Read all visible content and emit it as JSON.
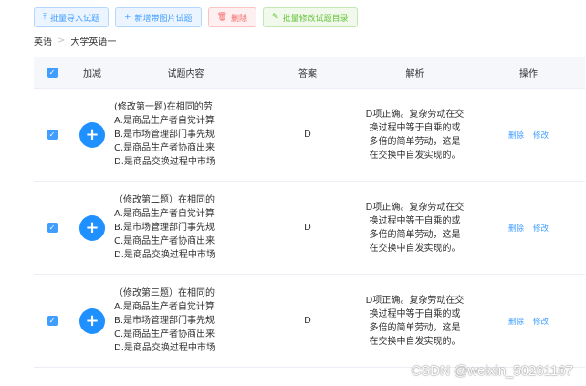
{
  "toolbar": {
    "import_label": "批量导入试题",
    "add_image_label": "新增带图片试题",
    "delete_label": "删除",
    "batch_edit_label": "批量修改试题目录"
  },
  "breadcrumb": [
    "英语",
    "大学英语一"
  ],
  "table": {
    "headers": {
      "add": "加减",
      "content": "试题内容",
      "answer": "答案",
      "analysis": "解析",
      "ops": "操作"
    },
    "rows": [
      {
        "content": [
          "(修改第一题)在相同的劳",
          "A.是商品生产者自觉计算",
          "B.是市场管理部门事先规",
          "C.是商品生产者协商出来",
          "D.是商品交换过程中市场"
        ],
        "answer": "D",
        "analysis": "D项正确。复杂劳动在交换过程中等于自乘的或多倍的简单劳动，这是在交换中自发实现的。",
        "delete": "删除",
        "edit": "修改"
      },
      {
        "content": [
          "（修改第二题）在相同的",
          "A.是商品生产者自觉计算",
          "B.是市场管理部门事先规",
          "C.是商品生产者协商出来",
          "D.是商品交换过程中市场"
        ],
        "answer": "D",
        "analysis": "D项正确。复杂劳动在交换过程中等于自乘的或多倍的简单劳动，这是在交换中自发实现的。",
        "delete": "删除",
        "edit": "修改"
      },
      {
        "content": [
          "（修改第三题）在相同的",
          "A.是商品生产者自觉计算",
          "B.是市场管理部门事先规",
          "C.是商品生产者协商出来",
          "D.是商品交换过程中市场"
        ],
        "answer": "D",
        "analysis": "D项正确。复杂劳动在交换过程中等于自乘的或多倍的简单劳动，这是在交换中自发实现的。",
        "delete": "删除",
        "edit": "修改"
      }
    ]
  },
  "watermark": "CSDN @weixin_50261167",
  "colors": {
    "primary": "#409eff",
    "danger": "#f56c6c",
    "success": "#67c23a",
    "add_button": "#1e90ff"
  }
}
